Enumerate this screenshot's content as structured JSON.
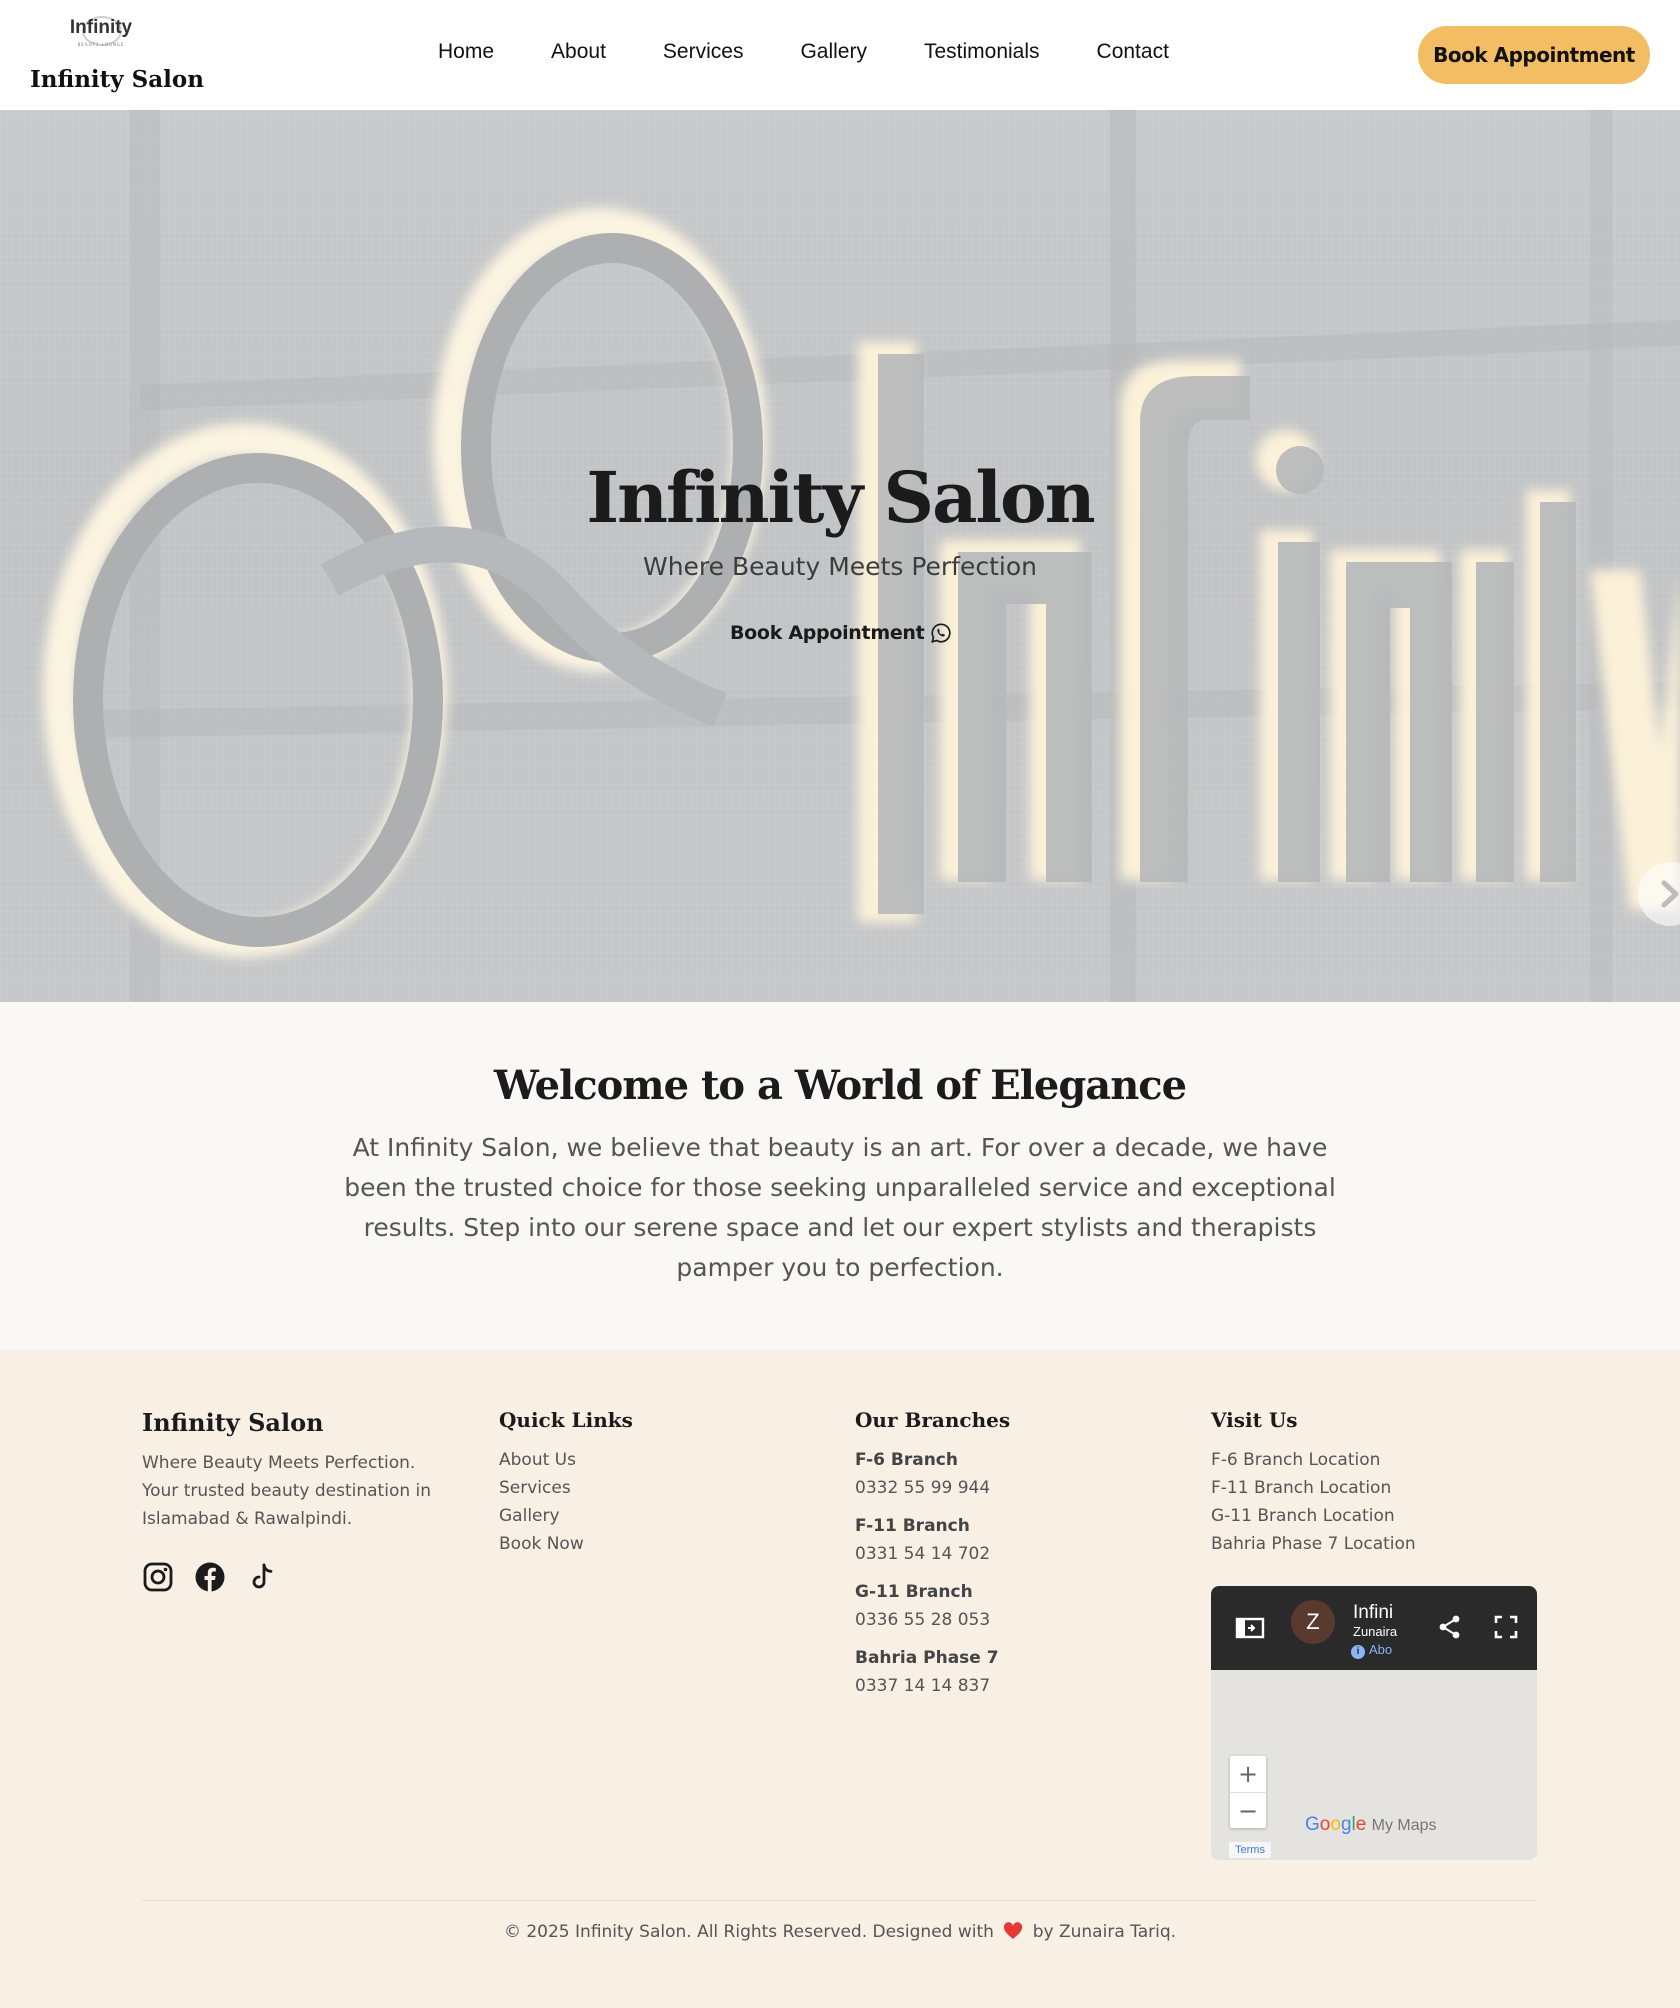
{
  "header": {
    "logo_word": "Infinity",
    "logo_tag": "BEAUTY LOUNGE",
    "brand": "Infinity Salon",
    "nav": [
      "Home",
      "About",
      "Services",
      "Gallery",
      "Testimonials",
      "Contact"
    ],
    "cta": "Book Appointment"
  },
  "hero": {
    "title": "Infinity Salon",
    "subtitle": "Where Beauty Meets Perfection",
    "cta": "Book Appointment",
    "cta_icon": "whatsapp-icon",
    "next_icon": "chevron-right-icon"
  },
  "welcome": {
    "heading": "Welcome to a World of Elegance",
    "body": "At Infinity Salon, we believe that beauty is an art. For over a decade, we have been the trusted choice for those seeking unparalleled service and exceptional results. Step into our serene space and let our expert stylists and therapists pamper you to perfection."
  },
  "footer": {
    "about": {
      "title": "Infinity Salon",
      "text": "Where Beauty Meets Perfection. Your trusted beauty destination in Islamabad & Rawalpindi.",
      "social": [
        "instagram-icon",
        "facebook-icon",
        "tiktok-icon"
      ]
    },
    "quick_links": {
      "title": "Quick Links",
      "items": [
        "About Us",
        "Services",
        "Gallery",
        "Book Now"
      ]
    },
    "branches": {
      "title": "Our Branches",
      "items": [
        {
          "name": "F-6 Branch",
          "phone": "0332 55 99 944"
        },
        {
          "name": "F-11 Branch",
          "phone": "0331 54 14 702"
        },
        {
          "name": "G-11 Branch",
          "phone": "0336 55 28 053"
        },
        {
          "name": "Bahria Phase 7",
          "phone": "0337 14 14 837"
        }
      ]
    },
    "visit": {
      "title": "Visit Us",
      "items": [
        "F-6 Branch Location",
        "F-11 Branch Location",
        "G-11 Branch Location",
        "Bahria Phase 7 Location"
      ]
    },
    "map": {
      "avatar_letter": "Z",
      "title": "Infini",
      "owner": "Zunaira",
      "about": "Abo",
      "zoom_in": "+",
      "zoom_out": "−",
      "brand": "My Maps",
      "terms": "Terms"
    },
    "copyright_pre": "© 2025 Infinity Salon. All Rights Reserved. Designed with",
    "copyright_post": "by Zunaira Tariq.",
    "heart_color": "#e53935"
  },
  "colors": {
    "accent": "#f2bd63",
    "welcome_bg": "#faf8f4",
    "footer_bg": "#f8efe5"
  }
}
